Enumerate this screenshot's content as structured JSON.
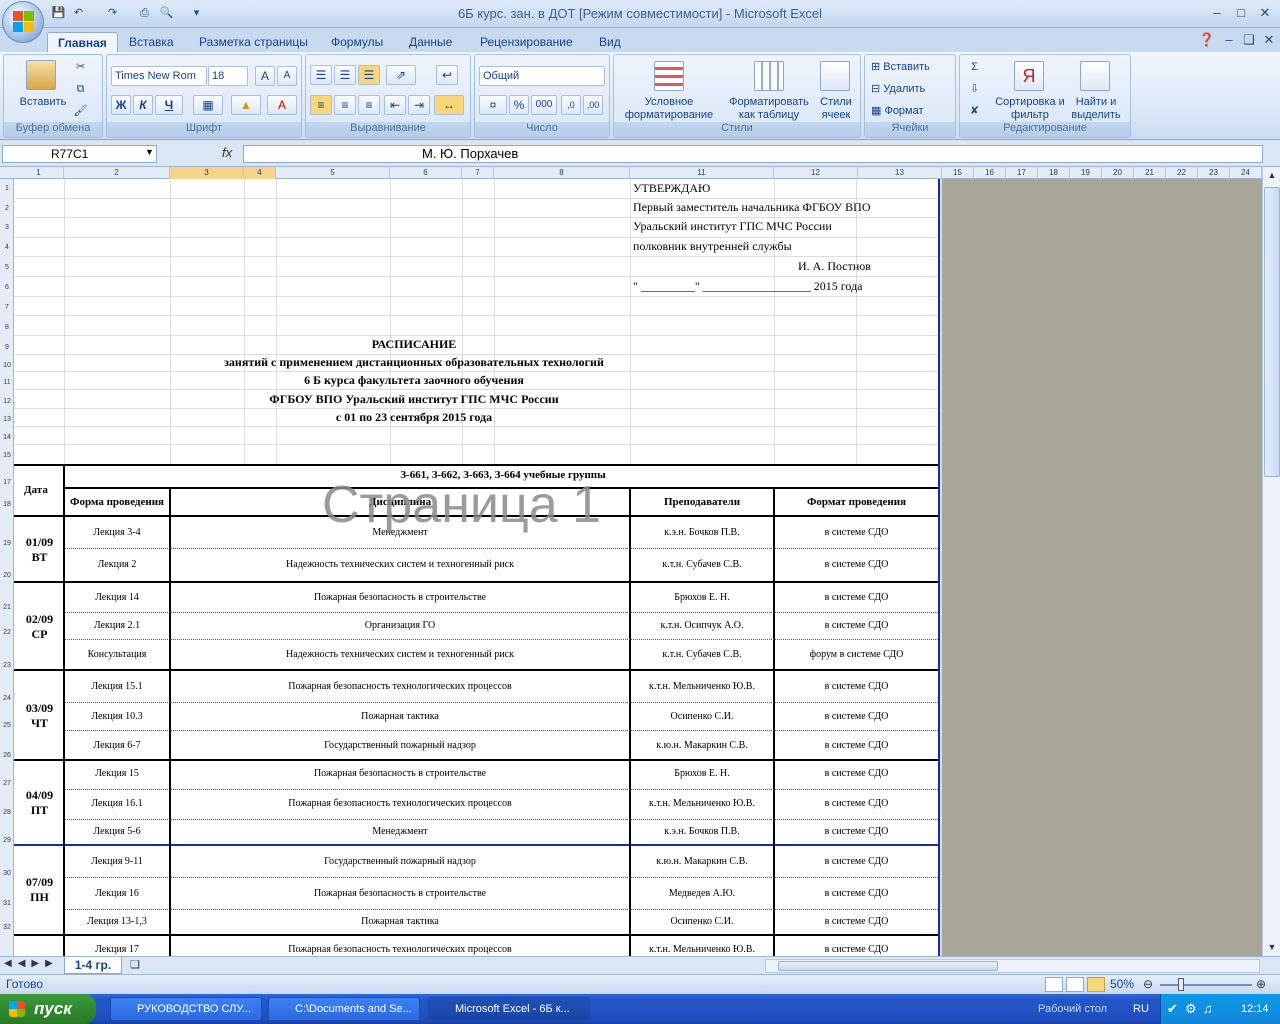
{
  "window": {
    "title": "6Б курс. зан. в ДОТ  [Режим совместимости] - Microsoft Excel"
  },
  "tabs": [
    "Главная",
    "Вставка",
    "Разметка страницы",
    "Формулы",
    "Данные",
    "Рецензирование",
    "Вид"
  ],
  "ribbon": {
    "clipboard": {
      "label": "Буфер обмена",
      "paste": "Вставить"
    },
    "font": {
      "label": "Шрифт",
      "name": "Times New Rom",
      "size": "18",
      "bold": "Ж",
      "italic": "К",
      "underline": "Ч"
    },
    "align": {
      "label": "Выравнивание"
    },
    "number": {
      "label": "Число",
      "format": "Общий",
      "pct": "%",
      "thousands": "000"
    },
    "styles": {
      "label": "Стили",
      "cond": "Условное форматирование",
      "table": "Форматировать как таблицу",
      "cell": "Стили ячеек"
    },
    "cells": {
      "label": "Ячейки",
      "insert": "Вставить",
      "delete": "Удалить",
      "format": "Формат"
    },
    "editing": {
      "label": "Редактирование",
      "sort": "Сортировка и фильтр",
      "find": "Найти и выделить"
    }
  },
  "formula": {
    "name_box": "R77C1",
    "fx": "fx",
    "content": "М. Ю. Порхачев"
  },
  "columns": [
    "1",
    "2",
    "3",
    "4",
    "5",
    "6",
    "7",
    "8",
    "11",
    "12",
    "13",
    "15",
    "16",
    "17",
    "18",
    "19",
    "20",
    "21",
    "22",
    "23",
    "24"
  ],
  "rows": [
    "1",
    "2",
    "3",
    "4",
    "5",
    "6",
    "7",
    "8",
    "9",
    "10",
    "11",
    "12",
    "13",
    "14",
    "15",
    "17",
    "18",
    "19",
    "20",
    "21",
    "22",
    "23",
    "24",
    "25",
    "26",
    "27",
    "28",
    "29",
    "30",
    "31",
    "32"
  ],
  "approval": {
    "l1": "УТВЕРЖДАЮ",
    "l2": "Первый заместитель начальника ФГБОУ ВПО",
    "l3": "Уральский институт ГПС МЧС России",
    "l4": "полковник внутренней службы",
    "l5": "И. А. Постнов",
    "l6": "\" _________\"  __________________ 2015 года"
  },
  "heading": {
    "h1": "РАСПИСАНИЕ",
    "h2": "занятий с применением дистанционных образовательных технологий",
    "h3": "6 Б курса факультета заочного обучения",
    "h4": "ФГБОУ ВПО Уральский институт ГПС МЧС России",
    "h5": "с 01 по 23 сентября 2015 года"
  },
  "table": {
    "groups": "З-661,  З-662,  З-663, З-664  учебные группы",
    "col_date": "Дата",
    "col_form": "Форма проведения",
    "col_disc": "Дисциплина",
    "col_teacher": "Преподаватели",
    "col_format": "Формат проведения"
  },
  "watermark": "Страница 1",
  "days": [
    {
      "date": "01/09",
      "dow": "ВТ"
    },
    {
      "date": "02/09",
      "dow": "СР"
    },
    {
      "date": "03/09",
      "dow": "ЧТ"
    },
    {
      "date": "04/09",
      "dow": "ПТ"
    },
    {
      "date": "07/09",
      "dow": "ПН"
    }
  ],
  "lessons": [
    {
      "form": "Лекция 3-4",
      "disc": "Менеджмент",
      "teacher": "к.э.н. Бочков П.В.",
      "format": "в системе СДО"
    },
    {
      "form": "Лекция 2",
      "disc": "Надежность технических систем и техногенный риск",
      "teacher": "к.т.н. Субачев С.В.",
      "format": "в системе СДО"
    },
    {
      "form": "Лекция 14",
      "disc": "Пожарная безопасность в строительстве",
      "teacher": "Брюхов Е. Н.",
      "format": "в системе СДО"
    },
    {
      "form": "Лекция 2.1",
      "disc": "Организация ГО",
      "teacher": "к.т.н. Осипчук А.О.",
      "format": "в системе СДО"
    },
    {
      "form": "Консультация",
      "disc": "Надежность технических систем и техногенный риск",
      "teacher": "к.т.н. Субачев С.В.",
      "format": "форум в системе СДО"
    },
    {
      "form": "Лекция 15.1",
      "disc": "Пожарная безопасность технологических процессов",
      "teacher": "к.т.н. Мельниченко Ю.В.",
      "format": "в системе СДО"
    },
    {
      "form": "Лекция 10.3",
      "disc": "Пожарная тактика",
      "teacher": "Осипенко С.И.",
      "format": "в системе СДО"
    },
    {
      "form": "Лекция 6-7",
      "disc": "Государственный пожарный надзор",
      "teacher": "к.ю.н. Макаркин С.В.",
      "format": "в системе СДО"
    },
    {
      "form": "Лекция 15",
      "disc": "Пожарная безопасность в строительстве",
      "teacher": "Брюхов Е. Н.",
      "format": "в системе СДО"
    },
    {
      "form": "Лекция 16.1",
      "disc": "Пожарная безопасность технологических процессов",
      "teacher": "к.т.н. Мельниченко Ю.В.",
      "format": "в системе СДО"
    },
    {
      "form": "Лекция 5-6",
      "disc": "Менеджмент",
      "teacher": "к.э.н. Бочков П.В.",
      "format": "в системе СДО"
    },
    {
      "form": "Лекция 9-11",
      "disc": "Государственный пожарный надзор",
      "teacher": "к.ю.н. Макаркин С.В.",
      "format": "в системе СДО"
    },
    {
      "form": "Лекция 16",
      "disc": "Пожарная безопасность в строительстве",
      "teacher": "Медведев А.Ю.",
      "format": "в системе СДО"
    },
    {
      "form": "Лекция 13-1,3",
      "disc": "Пожарная тактика",
      "teacher": "Осипенко С.И.",
      "format": "в системе СДО"
    },
    {
      "form": "Лекция 17",
      "disc": "Пожарная безопасность технологических процессов",
      "teacher": "к.т.н. Мельниченко Ю.В.",
      "format": "в системе СДО"
    }
  ],
  "sheet_tab": "1-4 гр.",
  "status": {
    "ready": "Готово",
    "zoom": "50%"
  },
  "taskbar": {
    "start": "пуск",
    "items": [
      "РУКОВОДСТВО СЛУ...",
      "C:\\Documents and Se...",
      "Microsoft Excel - 6Б к..."
    ],
    "desktop": "Рабочий стол",
    "lang": "RU",
    "clock": "12:14"
  }
}
